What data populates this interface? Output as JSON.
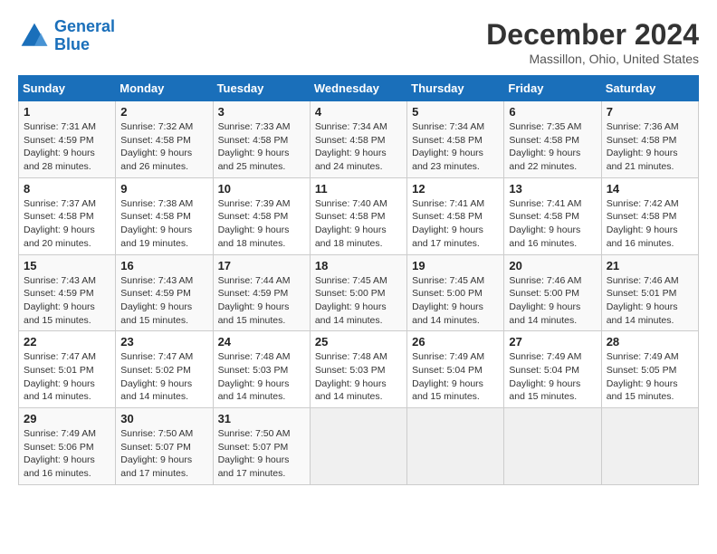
{
  "header": {
    "logo_line1": "General",
    "logo_line2": "Blue",
    "title": "December 2024",
    "subtitle": "Massillon, Ohio, United States"
  },
  "calendar": {
    "days_of_week": [
      "Sunday",
      "Monday",
      "Tuesday",
      "Wednesday",
      "Thursday",
      "Friday",
      "Saturday"
    ],
    "weeks": [
      [
        null,
        null,
        null,
        null,
        null,
        null,
        null
      ]
    ]
  },
  "days": [
    {
      "num": "1",
      "sunrise": "7:31 AM",
      "sunset": "4:59 PM",
      "daylight": "9 hours and 28 minutes."
    },
    {
      "num": "2",
      "sunrise": "7:32 AM",
      "sunset": "4:58 PM",
      "daylight": "9 hours and 26 minutes."
    },
    {
      "num": "3",
      "sunrise": "7:33 AM",
      "sunset": "4:58 PM",
      "daylight": "9 hours and 25 minutes."
    },
    {
      "num": "4",
      "sunrise": "7:34 AM",
      "sunset": "4:58 PM",
      "daylight": "9 hours and 24 minutes."
    },
    {
      "num": "5",
      "sunrise": "7:34 AM",
      "sunset": "4:58 PM",
      "daylight": "9 hours and 23 minutes."
    },
    {
      "num": "6",
      "sunrise": "7:35 AM",
      "sunset": "4:58 PM",
      "daylight": "9 hours and 22 minutes."
    },
    {
      "num": "7",
      "sunrise": "7:36 AM",
      "sunset": "4:58 PM",
      "daylight": "9 hours and 21 minutes."
    },
    {
      "num": "8",
      "sunrise": "7:37 AM",
      "sunset": "4:58 PM",
      "daylight": "9 hours and 20 minutes."
    },
    {
      "num": "9",
      "sunrise": "7:38 AM",
      "sunset": "4:58 PM",
      "daylight": "9 hours and 19 minutes."
    },
    {
      "num": "10",
      "sunrise": "7:39 AM",
      "sunset": "4:58 PM",
      "daylight": "9 hours and 18 minutes."
    },
    {
      "num": "11",
      "sunrise": "7:40 AM",
      "sunset": "4:58 PM",
      "daylight": "9 hours and 18 minutes."
    },
    {
      "num": "12",
      "sunrise": "7:41 AM",
      "sunset": "4:58 PM",
      "daylight": "9 hours and 17 minutes."
    },
    {
      "num": "13",
      "sunrise": "7:41 AM",
      "sunset": "4:58 PM",
      "daylight": "9 hours and 16 minutes."
    },
    {
      "num": "14",
      "sunrise": "7:42 AM",
      "sunset": "4:58 PM",
      "daylight": "9 hours and 16 minutes."
    },
    {
      "num": "15",
      "sunrise": "7:43 AM",
      "sunset": "4:59 PM",
      "daylight": "9 hours and 15 minutes."
    },
    {
      "num": "16",
      "sunrise": "7:43 AM",
      "sunset": "4:59 PM",
      "daylight": "9 hours and 15 minutes."
    },
    {
      "num": "17",
      "sunrise": "7:44 AM",
      "sunset": "4:59 PM",
      "daylight": "9 hours and 15 minutes."
    },
    {
      "num": "18",
      "sunrise": "7:45 AM",
      "sunset": "5:00 PM",
      "daylight": "9 hours and 14 minutes."
    },
    {
      "num": "19",
      "sunrise": "7:45 AM",
      "sunset": "5:00 PM",
      "daylight": "9 hours and 14 minutes."
    },
    {
      "num": "20",
      "sunrise": "7:46 AM",
      "sunset": "5:00 PM",
      "daylight": "9 hours and 14 minutes."
    },
    {
      "num": "21",
      "sunrise": "7:46 AM",
      "sunset": "5:01 PM",
      "daylight": "9 hours and 14 minutes."
    },
    {
      "num": "22",
      "sunrise": "7:47 AM",
      "sunset": "5:01 PM",
      "daylight": "9 hours and 14 minutes."
    },
    {
      "num": "23",
      "sunrise": "7:47 AM",
      "sunset": "5:02 PM",
      "daylight": "9 hours and 14 minutes."
    },
    {
      "num": "24",
      "sunrise": "7:48 AM",
      "sunset": "5:03 PM",
      "daylight": "9 hours and 14 minutes."
    },
    {
      "num": "25",
      "sunrise": "7:48 AM",
      "sunset": "5:03 PM",
      "daylight": "9 hours and 14 minutes."
    },
    {
      "num": "26",
      "sunrise": "7:49 AM",
      "sunset": "5:04 PM",
      "daylight": "9 hours and 15 minutes."
    },
    {
      "num": "27",
      "sunrise": "7:49 AM",
      "sunset": "5:04 PM",
      "daylight": "9 hours and 15 minutes."
    },
    {
      "num": "28",
      "sunrise": "7:49 AM",
      "sunset": "5:05 PM",
      "daylight": "9 hours and 15 minutes."
    },
    {
      "num": "29",
      "sunrise": "7:49 AM",
      "sunset": "5:06 PM",
      "daylight": "9 hours and 16 minutes."
    },
    {
      "num": "30",
      "sunrise": "7:50 AM",
      "sunset": "5:07 PM",
      "daylight": "9 hours and 17 minutes."
    },
    {
      "num": "31",
      "sunrise": "7:50 AM",
      "sunset": "5:07 PM",
      "daylight": "9 hours and 17 minutes."
    }
  ],
  "colors": {
    "header_bg": "#1a6fba",
    "odd_row": "#f9f9f9",
    "even_row": "#ffffff",
    "empty_cell": "#f0f0f0"
  }
}
